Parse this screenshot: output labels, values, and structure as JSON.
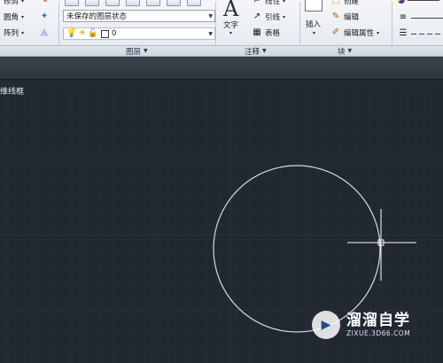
{
  "ribbon": {
    "modify": {
      "items": [
        {
          "label": "修剪",
          "icon": "trim-icon"
        },
        {
          "label": "圆角",
          "icon": "fillet-icon"
        },
        {
          "label": "阵列",
          "icon": "array-icon"
        }
      ]
    },
    "layers": {
      "title": "图层",
      "layer_state": "未保存的图层状态",
      "current_layer": "0"
    },
    "annotation": {
      "title": "注释",
      "text_label": "文字",
      "linear_label": "线性",
      "leader_label": "引线",
      "table_label": "表格"
    },
    "block": {
      "title": "块",
      "insert_label": "插入",
      "create_label": "创建",
      "edit_label": "编辑",
      "edit_attr_label": "编辑属性"
    }
  },
  "viewport": {
    "label": "维线框"
  },
  "watermark": {
    "name": "溜溜自学",
    "url": "ZIXUE.3D66.COM"
  },
  "colors": {
    "canvas_bg": "#212830",
    "grid_minor": "#2a313a",
    "grid_major": "#323a44",
    "circle": "#d7dbe0",
    "crosshair": "#ffffff"
  }
}
